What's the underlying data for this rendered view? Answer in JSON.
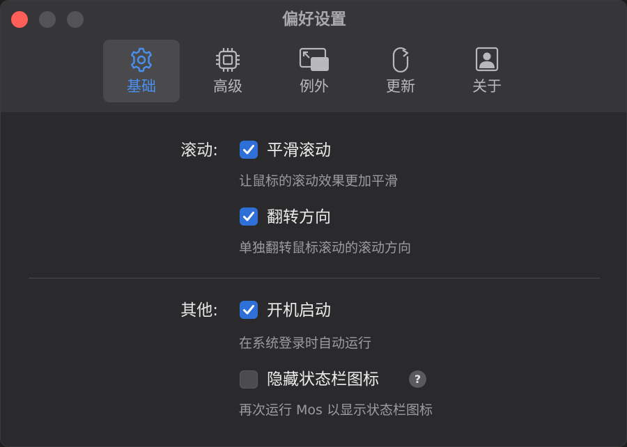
{
  "window": {
    "title": "偏好设置"
  },
  "tabs": [
    {
      "label": "基础",
      "icon": "gear-icon",
      "active": true
    },
    {
      "label": "高级",
      "icon": "cpu-chip-icon",
      "active": false
    },
    {
      "label": "例外",
      "icon": "window-resize-icon",
      "active": false
    },
    {
      "label": "更新",
      "icon": "refresh-icon",
      "active": false
    },
    {
      "label": "关于",
      "icon": "person-card-icon",
      "active": false
    }
  ],
  "scroll_section": {
    "label": "滚动:",
    "options": [
      {
        "label": "平滑滚动",
        "description": "让鼠标的滚动效果更加平滑",
        "checked": true
      },
      {
        "label": "翻转方向",
        "description": "单独翻转鼠标滚动的滚动方向",
        "checked": true
      }
    ]
  },
  "other_section": {
    "label": "其他:",
    "options": [
      {
        "label": "开机启动",
        "description": "在系统登录时自动运行",
        "checked": true
      },
      {
        "label": "隐藏状态栏图标",
        "description": "再次运行 Mos 以显示状态栏图标",
        "checked": false
      }
    ],
    "help_glyph": "?"
  },
  "colors": {
    "accent": "#2f6fd8",
    "active_tab_text": "#4a90f0",
    "close_button": "#ff5f57"
  }
}
